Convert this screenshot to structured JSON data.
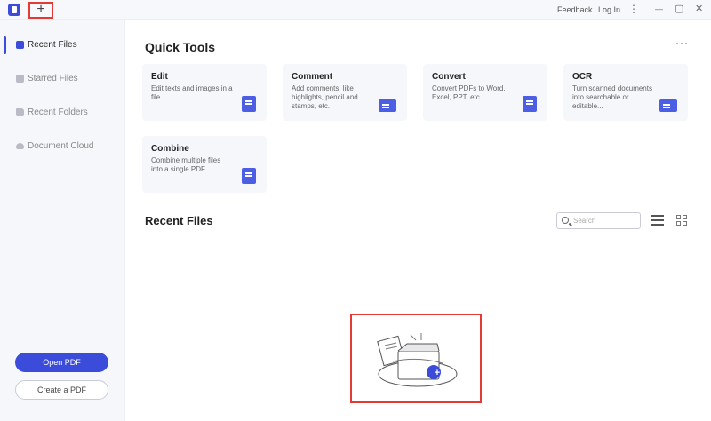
{
  "titlebar": {
    "new_tab_label": "+",
    "feedback": "Feedback",
    "login": "Log In",
    "menu_glyph": "⋮",
    "minimize_glyph": "—",
    "maximize_glyph": "▢",
    "close_glyph": "✕"
  },
  "sidebar": {
    "items": [
      {
        "label": "Recent Files",
        "icon": "document-icon",
        "active": true
      },
      {
        "label": "Starred Files",
        "icon": "star-file-icon",
        "active": false
      },
      {
        "label": "Recent Folders",
        "icon": "folder-icon",
        "active": false
      },
      {
        "label": "Document Cloud",
        "icon": "cloud-icon",
        "active": false
      }
    ],
    "open_pdf": "Open PDF",
    "create_pdf": "Create a PDF"
  },
  "quick_tools": {
    "title": "Quick Tools",
    "more": "···",
    "cards": [
      {
        "title": "Edit",
        "desc": "Edit texts and images in a file.",
        "icon": "edit-doc-icon"
      },
      {
        "title": "Comment",
        "desc": "Add comments, like highlights, pencil and stamps, etc.",
        "icon": "comment-icon"
      },
      {
        "title": "Convert",
        "desc": "Convert PDFs to Word, Excel, PPT, etc.",
        "icon": "convert-icon"
      },
      {
        "title": "OCR",
        "desc": "Turn scanned documents into searchable or editable...",
        "icon": "ocr-icon"
      },
      {
        "title": "Combine",
        "desc": "Combine multiple files into a single PDF.",
        "icon": "combine-icon"
      }
    ]
  },
  "recent_files": {
    "title": "Recent Files",
    "search_placeholder": "Search",
    "list_view_icon": "list-view-icon",
    "grid_view_icon": "grid-view-icon",
    "add_glyph": "+"
  },
  "colors": {
    "accent": "#3b4cdb",
    "highlight": "#e53935",
    "sidebar_bg": "#f6f7fb"
  }
}
